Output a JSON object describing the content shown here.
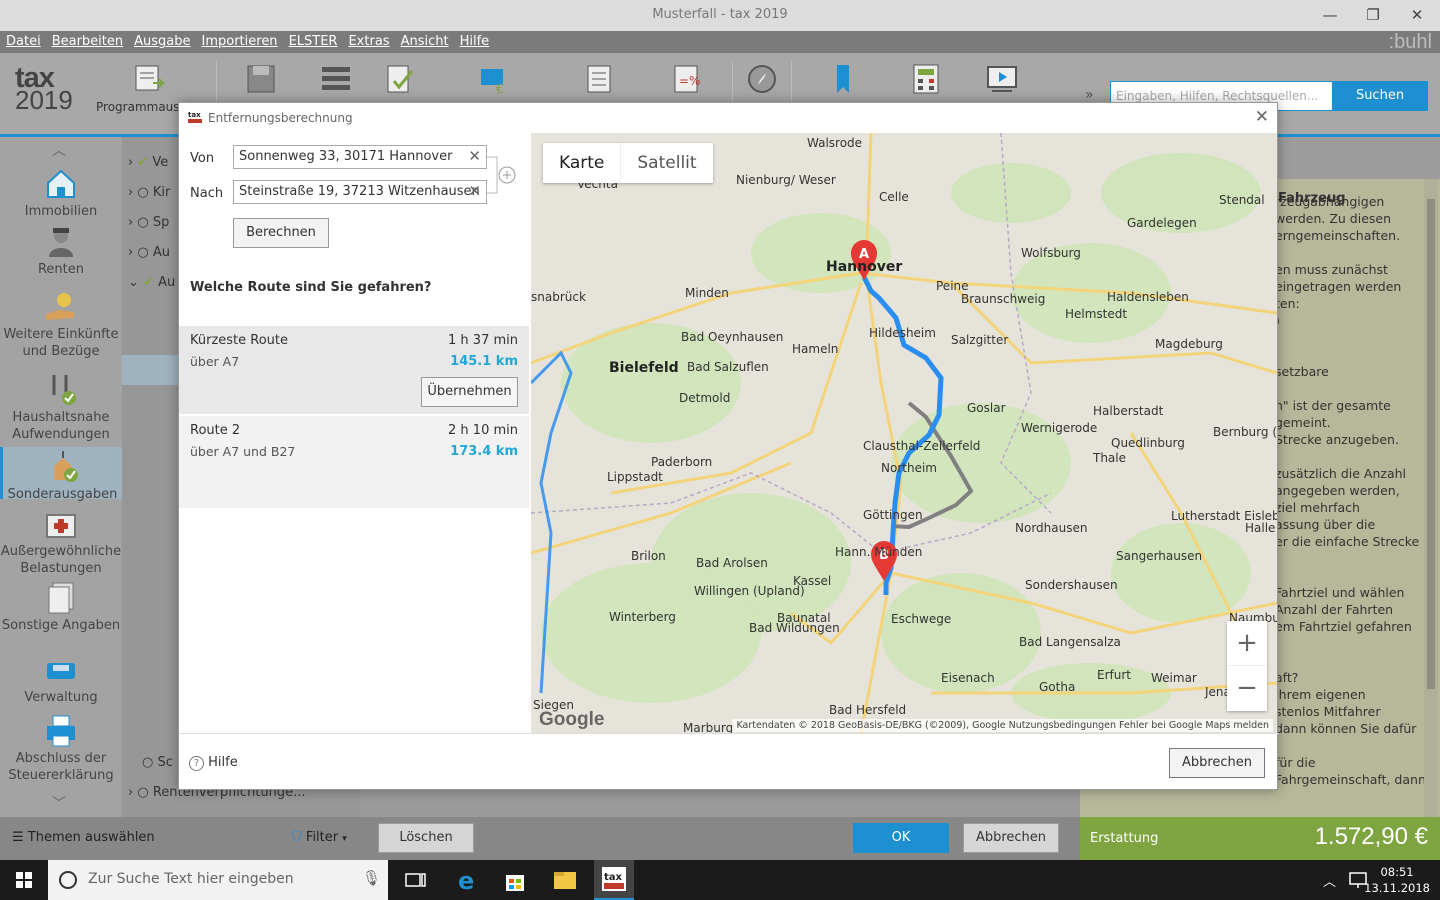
{
  "window": {
    "title": "Musterfall - tax 2019",
    "minimize": "—",
    "maximize": "❐",
    "close": "✕"
  },
  "menu": [
    "Datei",
    "Bearbeiten",
    "Ausgabe",
    "Importieren",
    "ELSTER",
    "Extras",
    "Ansicht",
    "Hilfe"
  ],
  "brand": ":buhl",
  "logo": {
    "line1": "tax",
    "line2": "2019"
  },
  "toolbar": {
    "program_label": "Programmaus",
    "chevron": "»",
    "search_placeholder": "Eingaben, Hilfen, Rechtsquellen...",
    "search_button": "Suchen"
  },
  "sidebar": [
    {
      "label": "Immobilien"
    },
    {
      "label": "Renten"
    },
    {
      "label": "Weitere Einkünfte und Bezüge"
    },
    {
      "label": "Haushaltsnahe Aufwendungen"
    },
    {
      "label": "Sonderausgaben"
    },
    {
      "label": "Außergewöhnliche Belastungen"
    },
    {
      "label": "Sonstige Angaben"
    },
    {
      "label": "Verwaltung"
    },
    {
      "label": "Abschluss der Steuererklärung"
    }
  ],
  "tree": [
    {
      "text": "Ve"
    },
    {
      "text": "Kir"
    },
    {
      "text": "Sp"
    },
    {
      "text": "Au"
    },
    {
      "text": "Au"
    },
    {
      "text": "Sc"
    },
    {
      "text": "Rentenverpflichtunge..."
    }
  ],
  "right_panel": {
    "heading": "Fahrzeug",
    "lines": [
      "rzeugabhängigen",
      "werden. Zu diesen",
      "erngemeinschaften.",
      "",
      "en muss zunächst",
      "eingetragen werden",
      "ten:",
      ")",
      "",
      "",
      "setzbare",
      "",
      "n\" ist der gesamte",
      "gemeint.",
      "Strecke anzugeben.",
      "",
      "zusätzlich die Anzahl",
      "angegeben werden,",
      "ziel mehrfach",
      "assung über die",
      "er die einfache Strecke",
      "",
      "",
      "Fahrtziel und wählen",
      "Anzahl der Fahrten",
      "em Fahrtziel gefahren",
      "",
      "",
      "aft?",
      "Ihrem eigenen",
      "stenlos Mitfahrer",
      "dann können Sie dafür",
      "",
      "für die",
      "Fahrgemeinschaft, dann können Sie diese unter"
    ]
  },
  "bottom": {
    "themen": "Themen auswählen",
    "filter": "Filter",
    "loeschen": "Löschen",
    "ok": "OK",
    "abbrechen": "Abbrechen",
    "erstattung_label": "Erstattung",
    "erstattung_value": "1.572,90 €"
  },
  "dialog": {
    "title": "Entfernungsberechnung",
    "von_label": "Von",
    "von_value": "Sonnenweg 33, 30171 Hannover",
    "nach_label": "Nach",
    "nach_value": "Steinstraße 19, 37213 Witzenhausen",
    "calc_button": "Berechnen",
    "question": "Welche Route sind Sie gefahren?",
    "routes": [
      {
        "name": "Kürzeste Route",
        "via": "über A7",
        "time": "1 h 37 min",
        "km": "145.1 km",
        "button": "Übernehmen"
      },
      {
        "name": "Route 2",
        "via": "über A7 und B27",
        "time": "2 h 10 min",
        "km": "173.4 km"
      }
    ],
    "help": "Hilfe",
    "cancel": "Abbrechen"
  },
  "map": {
    "type_map": "Karte",
    "type_satellite": "Satellit",
    "zoom_in": "+",
    "zoom_out": "−",
    "google": "Google",
    "attribution": "Kartendaten © 2018 GeoBasis-DE/BKG (©2009), Google    Nutzungsbedingungen    Fehler bei Google Maps melden",
    "marker_a": "A",
    "marker_b": "B",
    "cities": [
      {
        "name": "Walsrode",
        "big": false
      },
      {
        "name": "Vechta",
        "big": false
      },
      {
        "name": "Nienburg/ Weser",
        "big": false
      },
      {
        "name": "Celle",
        "big": false
      },
      {
        "name": "Stendal",
        "big": false
      },
      {
        "name": "Gardelegen",
        "big": false
      },
      {
        "name": "Wolfsburg",
        "big": false
      },
      {
        "name": "Hannover",
        "big": true
      },
      {
        "name": "Peine",
        "big": false
      },
      {
        "name": "Braunschweig",
        "big": false
      },
      {
        "name": "snabrück",
        "big": false
      },
      {
        "name": "Minden",
        "big": false
      },
      {
        "name": "Haldensleben",
        "big": false
      },
      {
        "name": "Helmstedt",
        "big": false
      },
      {
        "name": "Hildesheim",
        "big": false
      },
      {
        "name": "Salzgitter",
        "big": false
      },
      {
        "name": "Magdeburg",
        "big": false
      },
      {
        "name": "Bad Oeynhausen",
        "big": false
      },
      {
        "name": "Hameln",
        "big": false
      },
      {
        "name": "Bielefeld",
        "big": true
      },
      {
        "name": "Bad Salzuflen",
        "big": false
      },
      {
        "name": "Detmold",
        "big": false
      },
      {
        "name": "Goslar",
        "big": false
      },
      {
        "name": "Halberstadt",
        "big": false
      },
      {
        "name": "Wernigerode",
        "big": false
      },
      {
        "name": "Quedlinburg",
        "big": false
      },
      {
        "name": "Bernburg (Saale)",
        "big": false
      },
      {
        "name": "Clausthal-Zellerfeld",
        "big": false
      },
      {
        "name": "Thale",
        "big": false
      },
      {
        "name": "Paderborn",
        "big": false
      },
      {
        "name": "Northeim",
        "big": false
      },
      {
        "name": "Lippstadt",
        "big": false
      },
      {
        "name": "Göttingen",
        "big": false
      },
      {
        "name": "Nordhausen",
        "big": false
      },
      {
        "name": "Lutherstadt Eisleben",
        "big": false
      },
      {
        "name": "Halle (S",
        "big": false
      },
      {
        "name": "Brilon",
        "big": false
      },
      {
        "name": "Bad Arolsen",
        "big": false
      },
      {
        "name": "Hann. Münden",
        "big": false
      },
      {
        "name": "Sangerhausen",
        "big": false
      },
      {
        "name": "Kassel",
        "big": false
      },
      {
        "name": "Sondershausen",
        "big": false
      },
      {
        "name": "Willingen (Upland)",
        "big": false
      },
      {
        "name": "Baunatal",
        "big": false
      },
      {
        "name": "Winterberg",
        "big": false
      },
      {
        "name": "Eschwege",
        "big": false
      },
      {
        "name": "Naumburg (Saale)",
        "big": false
      },
      {
        "name": "Bad Wildungen",
        "big": false
      },
      {
        "name": "Bad Langensalza",
        "big": false
      },
      {
        "name": "Eisenach",
        "big": false
      },
      {
        "name": "Erfurt",
        "big": false
      },
      {
        "name": "Weimar",
        "big": false
      },
      {
        "name": "Jena",
        "big": false
      },
      {
        "name": "Gotha",
        "big": false
      },
      {
        "name": "Siegen",
        "big": false
      },
      {
        "name": "Bad Hersfeld",
        "big": false
      },
      {
        "name": "Marburg",
        "big": false
      }
    ]
  },
  "taskbar": {
    "search": "Zur Suche Text hier eingeben",
    "time": "08:51",
    "date": "13.11.2018"
  },
  "colors": {
    "accent": "#1e8fd0",
    "route_primary": "#2a8df0",
    "route_alt": "#808080",
    "erstattung": "#7fa541",
    "km": "#1fa8d8"
  }
}
